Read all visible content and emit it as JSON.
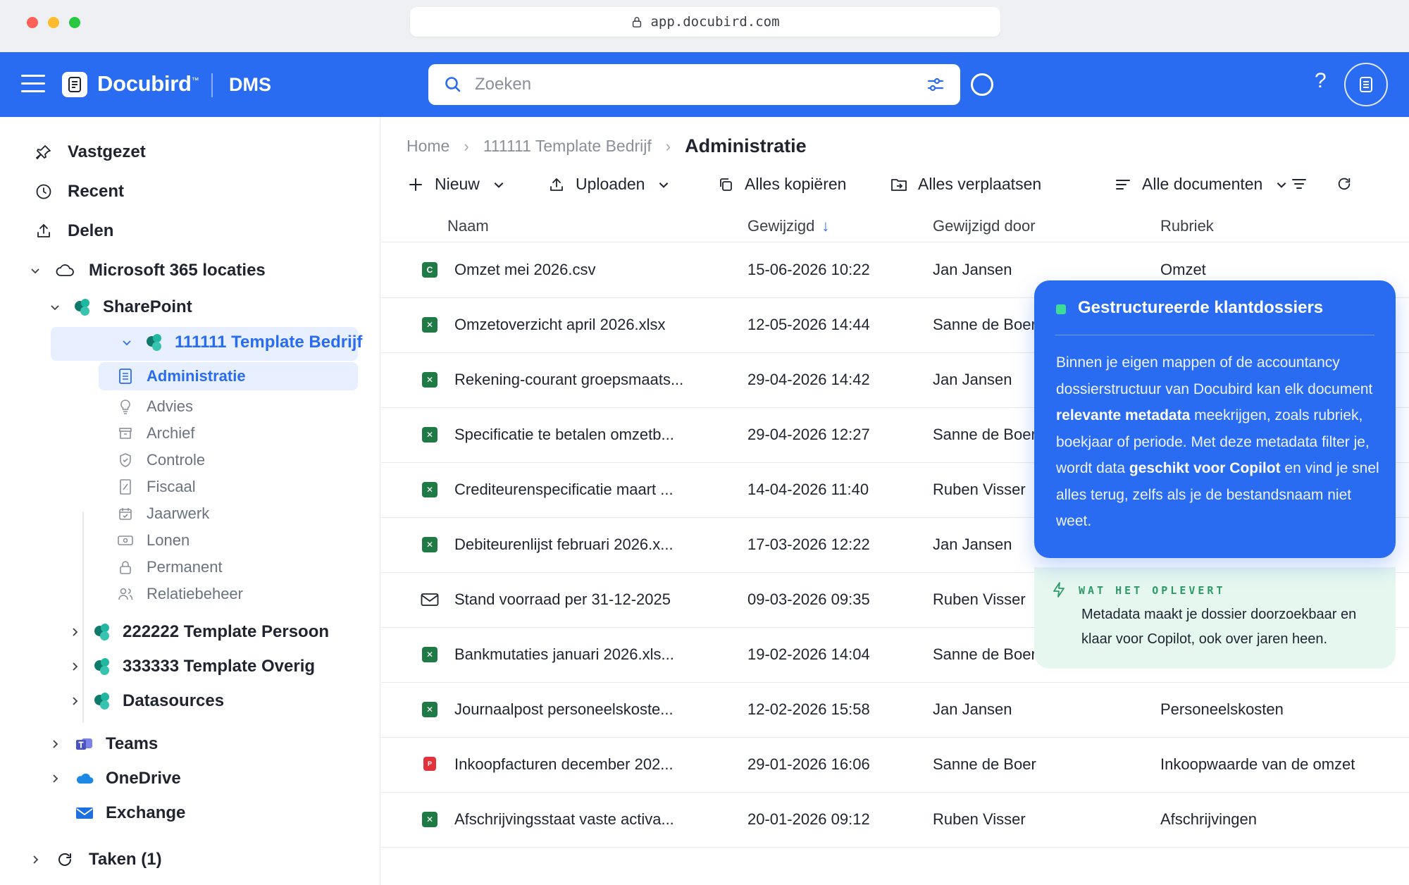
{
  "browser": {
    "url": "app.docubird.com"
  },
  "appbar": {
    "brand": "Docubird",
    "brand_tm": "™",
    "module": "DMS",
    "search_placeholder": "Zoeken",
    "help": "?",
    "accent": "#2a6cf1"
  },
  "sidebar": {
    "pinned": "Vastgezet",
    "recent": "Recent",
    "share": "Delen",
    "m365": "Microsoft 365 locaties",
    "sharepoint": "SharePoint",
    "site_selected": "111111 Template Bedrijf",
    "subfolders": [
      "Administratie",
      "Advies",
      "Archief",
      "Controle",
      "Fiscaal",
      "Jaarwerk",
      "Lonen",
      "Permanent",
      "Relatiebeheer"
    ],
    "site2": "222222 Template Persoon",
    "site3": "333333 Template Overig",
    "datasources": "Datasources",
    "teams": "Teams",
    "onedrive": "OneDrive",
    "exchange": "Exchange",
    "tasks": "Taken (1)"
  },
  "breadcrumb": {
    "home": "Home",
    "site": "111111 Template Bedrijf",
    "current": "Administratie"
  },
  "toolbar": {
    "new": "Nieuw",
    "upload": "Uploaden",
    "copy_all": "Alles kopiëren",
    "move_all": "Alles verplaatsen",
    "view": "Alle documenten"
  },
  "table": {
    "headers": {
      "name": "Naam",
      "modified": "Gewijzigd",
      "modified_by": "Gewijzigd door",
      "category": "Rubriek"
    },
    "rows": [
      {
        "type": "csv",
        "name": "Omzet mei 2026.csv",
        "modified": "15-06-2026 10:22",
        "by": "Jan Jansen",
        "category": "Omzet"
      },
      {
        "type": "xlsx",
        "name": "Omzetoverzicht april 2026.xlsx",
        "modified": "12-05-2026 14:44",
        "by": "Sanne de Boer",
        "category": ""
      },
      {
        "type": "xlsx",
        "name": "Rekening-courant groepsmaats...",
        "modified": "29-04-2026 14:42",
        "by": "Jan Jansen",
        "category": ""
      },
      {
        "type": "xlsx",
        "name": "Specificatie te betalen omzetb...",
        "modified": "29-04-2026 12:27",
        "by": "Sanne de Boer",
        "category": ""
      },
      {
        "type": "xlsx",
        "name": "Crediteurenspecificatie maart ...",
        "modified": "14-04-2026 11:40",
        "by": "Ruben Visser",
        "category": ""
      },
      {
        "type": "xlsx",
        "name": "Debiteurenlijst februari 2026.x...",
        "modified": "17-03-2026 12:22",
        "by": "Jan Jansen",
        "category": ""
      },
      {
        "type": "mail",
        "name": "Stand voorraad per 31-12-2025",
        "modified": "09-03-2026 09:35",
        "by": "Ruben Visser",
        "category": ""
      },
      {
        "type": "xlsx",
        "name": "Bankmutaties januari 2026.xls...",
        "modified": "19-02-2026 14:04",
        "by": "Sanne de Boer",
        "category": ""
      },
      {
        "type": "xlsx",
        "name": "Journaalpost personeelskoste...",
        "modified": "12-02-2026 15:58",
        "by": "Jan Jansen",
        "category": "Personeelskosten"
      },
      {
        "type": "pdf",
        "name": "Inkoopfacturen december 202...",
        "modified": "29-01-2026 16:06",
        "by": "Sanne de Boer",
        "category": "Inkoopwaarde van de omzet"
      },
      {
        "type": "xlsx",
        "name": "Afschrijvingsstaat vaste activa...",
        "modified": "20-01-2026 09:12",
        "by": "Ruben Visser",
        "category": "Afschrijvingen"
      }
    ]
  },
  "callout": {
    "title": "Gestructureerde klantdossiers",
    "body_1": "Binnen je eigen mappen of de accountancy dossierstructuur van Docubird kan elk document ",
    "body_bold_1": "relevante metadata",
    "body_2": " meekrijgen, zoals rubriek, boekjaar of periode. Met deze metadata filter je, wordt data ",
    "body_bold_2": "geschikt voor Copilot",
    "body_3": " en vind je snel alles terug, zelfs als je de bestandsnaam niet weet.",
    "benefit_label": "WAT HET OPLEVERT",
    "benefit_text": "Metadata maakt je dossier doorzoekbaar en klaar voor Copilot, ook over jaren heen."
  }
}
